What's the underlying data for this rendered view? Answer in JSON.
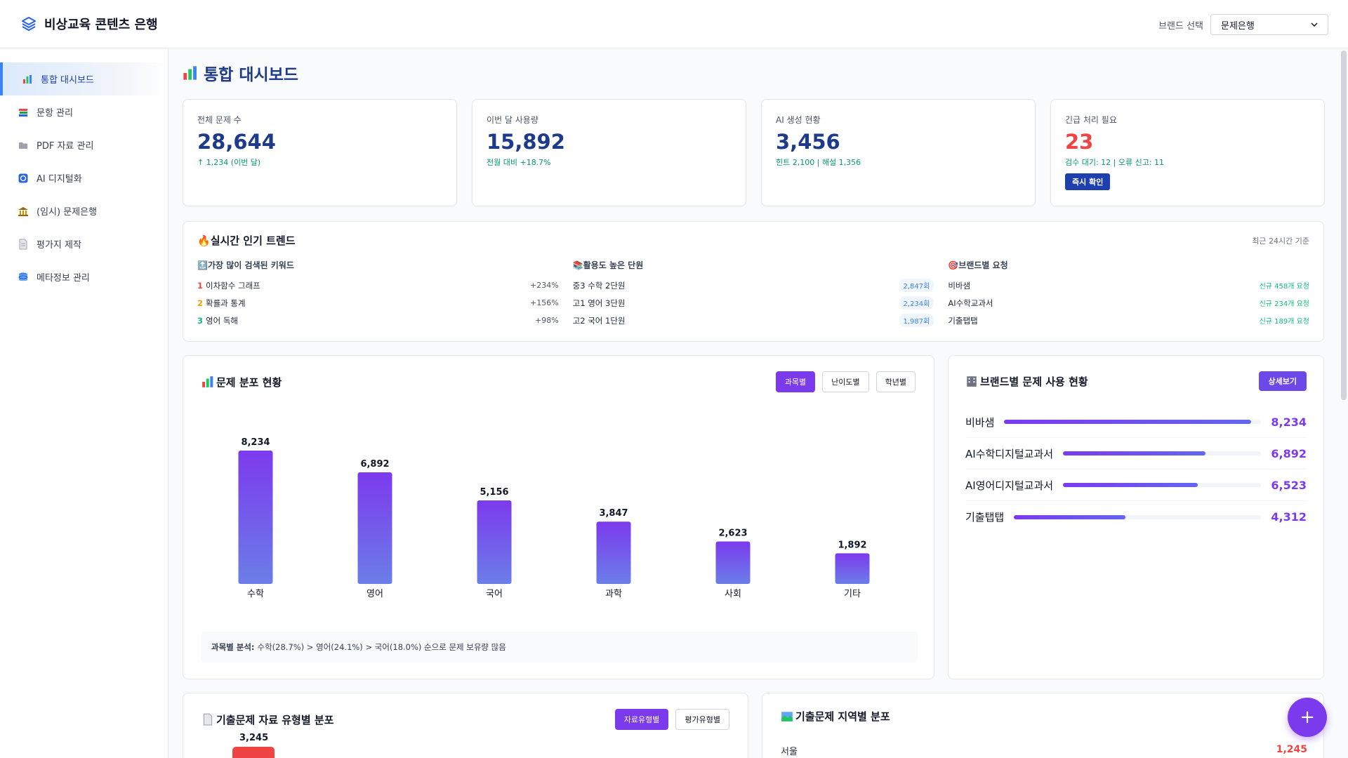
{
  "header": {
    "app_title": "비상교육 콘텐츠 은행",
    "brand_label": "브랜드 선택",
    "brand_selected": "문제은행"
  },
  "sidebar": {
    "items": [
      {
        "label": "통합 대시보드",
        "icon": "chart-icon",
        "active": true
      },
      {
        "label": "문항 관리",
        "icon": "books-icon"
      },
      {
        "label": "PDF 자료 관리",
        "icon": "folder-icon"
      },
      {
        "label": "AI 디지털화",
        "icon": "ai-icon"
      },
      {
        "label": "(임시) 문제은행",
        "icon": "bank-icon"
      },
      {
        "label": "평가지 제작",
        "icon": "document-icon"
      },
      {
        "label": "메타정보 관리",
        "icon": "database-icon"
      }
    ]
  },
  "main": {
    "title": "통합 대시보드",
    "stats": [
      {
        "label": "전체 문제 수",
        "value": "28,644",
        "sub": "↑ 1,234 (이번 달)"
      },
      {
        "label": "이번 달 사용량",
        "value": "15,892",
        "sub": "전월 대비 +18.7%"
      },
      {
        "label": "AI 생성 현황",
        "value": "3,456",
        "sub": "힌트 2,100 | 해설 1,356"
      },
      {
        "label": "긴급 처리 필요",
        "value": "23",
        "sub": "검수 대기: 12 | 오류 신고: 11",
        "button": "즉시 확인"
      }
    ],
    "trends": {
      "title": "실시간 인기 트렌드",
      "note": "최근 24시간 기준",
      "keywords": {
        "title": "가장 많이 검색된 키워드",
        "items": [
          {
            "rank": "1",
            "text": "이차함수 그래프",
            "value": "+234%"
          },
          {
            "rank": "2",
            "text": "확률과 통계",
            "value": "+156%"
          },
          {
            "rank": "3",
            "text": "영어 독해",
            "value": "+98%"
          }
        ]
      },
      "units": {
        "title": "활용도 높은 단원",
        "items": [
          {
            "text": "중3 수학 2단원",
            "value": "2,847회"
          },
          {
            "text": "고1 영어 3단원",
            "value": "2,234회"
          },
          {
            "text": "고2 국어 1단원",
            "value": "1,987회"
          }
        ]
      },
      "brands": {
        "title": "브랜드별 요청",
        "items": [
          {
            "text": "비바샘",
            "value": "신규 458개 요청"
          },
          {
            "text": "AI수학교과서",
            "value": "신규 234개 요청"
          },
          {
            "text": "기출탭탭",
            "value": "신규 189개 요청"
          }
        ]
      }
    },
    "distribution": {
      "title": "문제 분포 현황",
      "tabs": [
        "과목별",
        "난이도별",
        "학년별"
      ],
      "analysis_label": "과목별 분석:",
      "analysis_text": "수학(28.7%) > 영어(24.1%) > 국어(18.0%) 순으로 문제 보유량 많음"
    },
    "brand_usage": {
      "title": "브랜드별 문제 사용 현황",
      "button": "상세보기",
      "rows": [
        {
          "name": "비바샘",
          "value": "8,234",
          "ratio": 0.96
        },
        {
          "name": "AI수학디지털교과서",
          "value": "6,892",
          "ratio": 0.72
        },
        {
          "name": "AI영어디지털교과서",
          "value": "6,523",
          "ratio": 0.68
        },
        {
          "name": "기출탭탭",
          "value": "4,312",
          "ratio": 0.45
        }
      ]
    },
    "exam_types": {
      "title": "기출문제 자료 유형별 분포",
      "tabs": [
        "자료유형별",
        "평가유형별"
      ],
      "first_value": "3,245"
    },
    "regions": {
      "title": "기출문제 지역별 분포",
      "first_label": "서울",
      "first_value": "1,245"
    }
  },
  "chart_data": {
    "type": "bar",
    "categories": [
      "수학",
      "영어",
      "국어",
      "과학",
      "사회",
      "기타"
    ],
    "values": [
      8234,
      6892,
      5156,
      3847,
      2623,
      1892
    ],
    "labels": [
      "8,234",
      "6,892",
      "5,156",
      "3,847",
      "2,623",
      "1,892"
    ],
    "ylim": [
      0,
      8234
    ],
    "colors": [
      "#7c3aed",
      "#6b7ee8"
    ]
  },
  "fab": "+"
}
